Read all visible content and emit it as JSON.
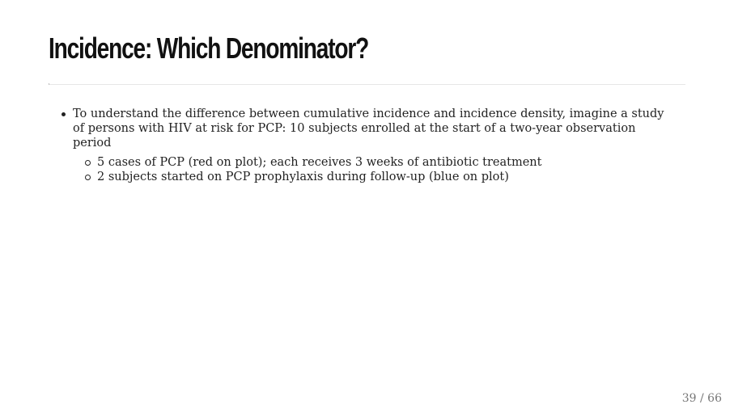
{
  "slide": {
    "title": "Incidence: Which Denominator?",
    "bullets": [
      {
        "text": "To understand the difference between cumulative incidence and incidence density, imagine a study of persons with HIV at risk for PCP: 10 subjects enrolled at the start of a two-year observation period",
        "sub": [
          "5 cases of PCP (red on plot); each receives 3 weeks of antibiotic treatment",
          "2 subjects started on PCP prophylaxis during follow-up (blue on plot)"
        ]
      }
    ],
    "slide_number": "39 / 66"
  }
}
